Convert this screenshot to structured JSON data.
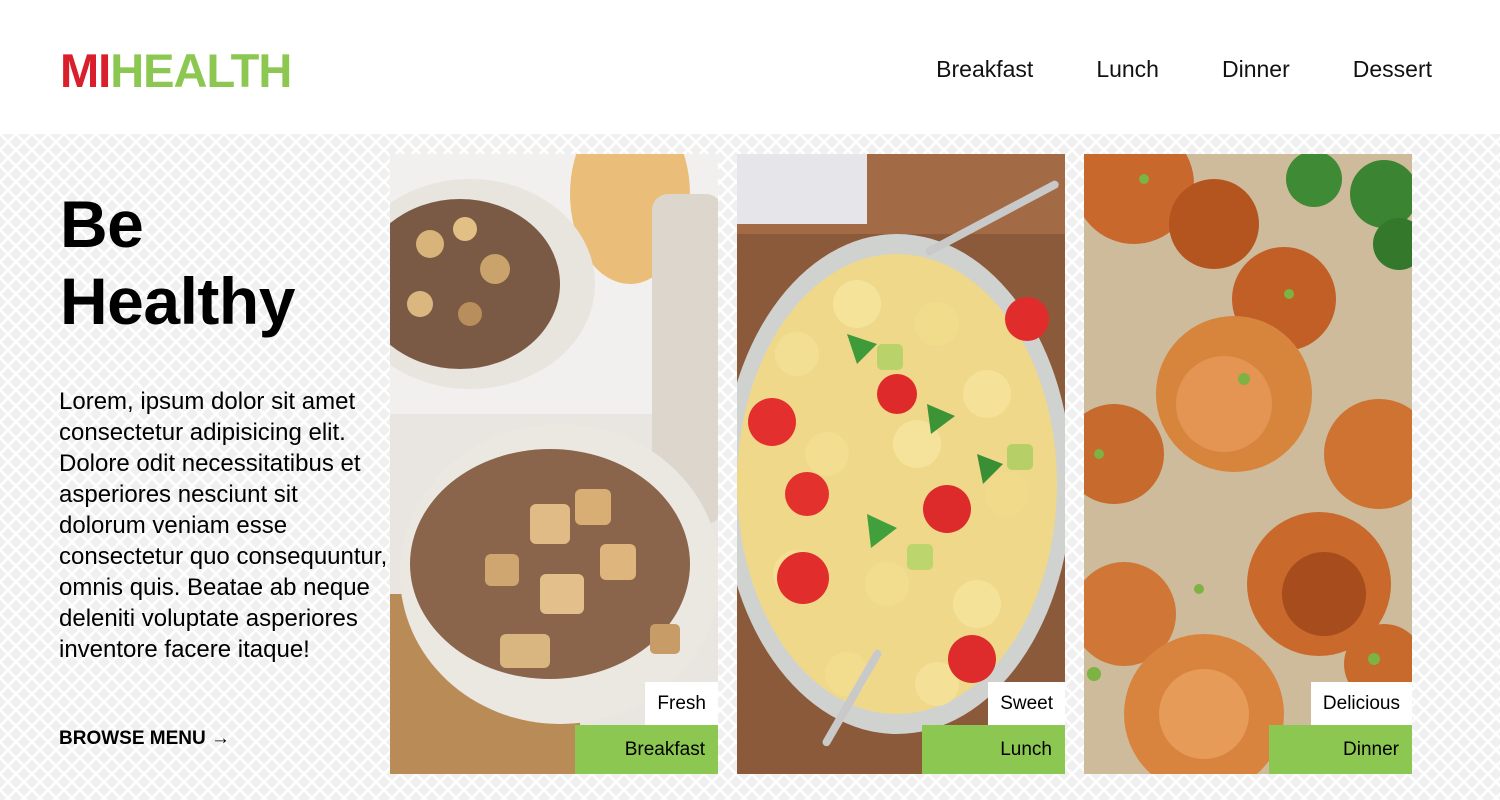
{
  "brand": {
    "part1": "MI",
    "part2": "HEALTH"
  },
  "nav": [
    {
      "label": "Breakfast"
    },
    {
      "label": "Lunch"
    },
    {
      "label": "Dinner"
    },
    {
      "label": "Dessert"
    }
  ],
  "hero": {
    "title_line1": "Be",
    "title_line2": "Healthy",
    "body": "Lorem, ipsum dolor sit amet consectetur adipisicing elit. Dolore odit necessitatibus et asperiores nesciunt sit dolorum veniam esse consectetur quo consequuntur, omnis quis. Beatae ab neque deleniti voluptate asperiores inventore facere itaque!",
    "cta": "BROWSE MENU →"
  },
  "cards": [
    {
      "tag": "Fresh",
      "category": "Breakfast",
      "image": "apple-crumble-bowls-photo"
    },
    {
      "tag": "Sweet",
      "category": "Lunch",
      "image": "pasta-salad-bowl-photo"
    },
    {
      "tag": "Delicious",
      "category": "Dinner",
      "image": "glazed-shrimp-rice-photo"
    }
  ],
  "colors": {
    "brand_red": "#d91f2b",
    "brand_green": "#8cc751"
  }
}
